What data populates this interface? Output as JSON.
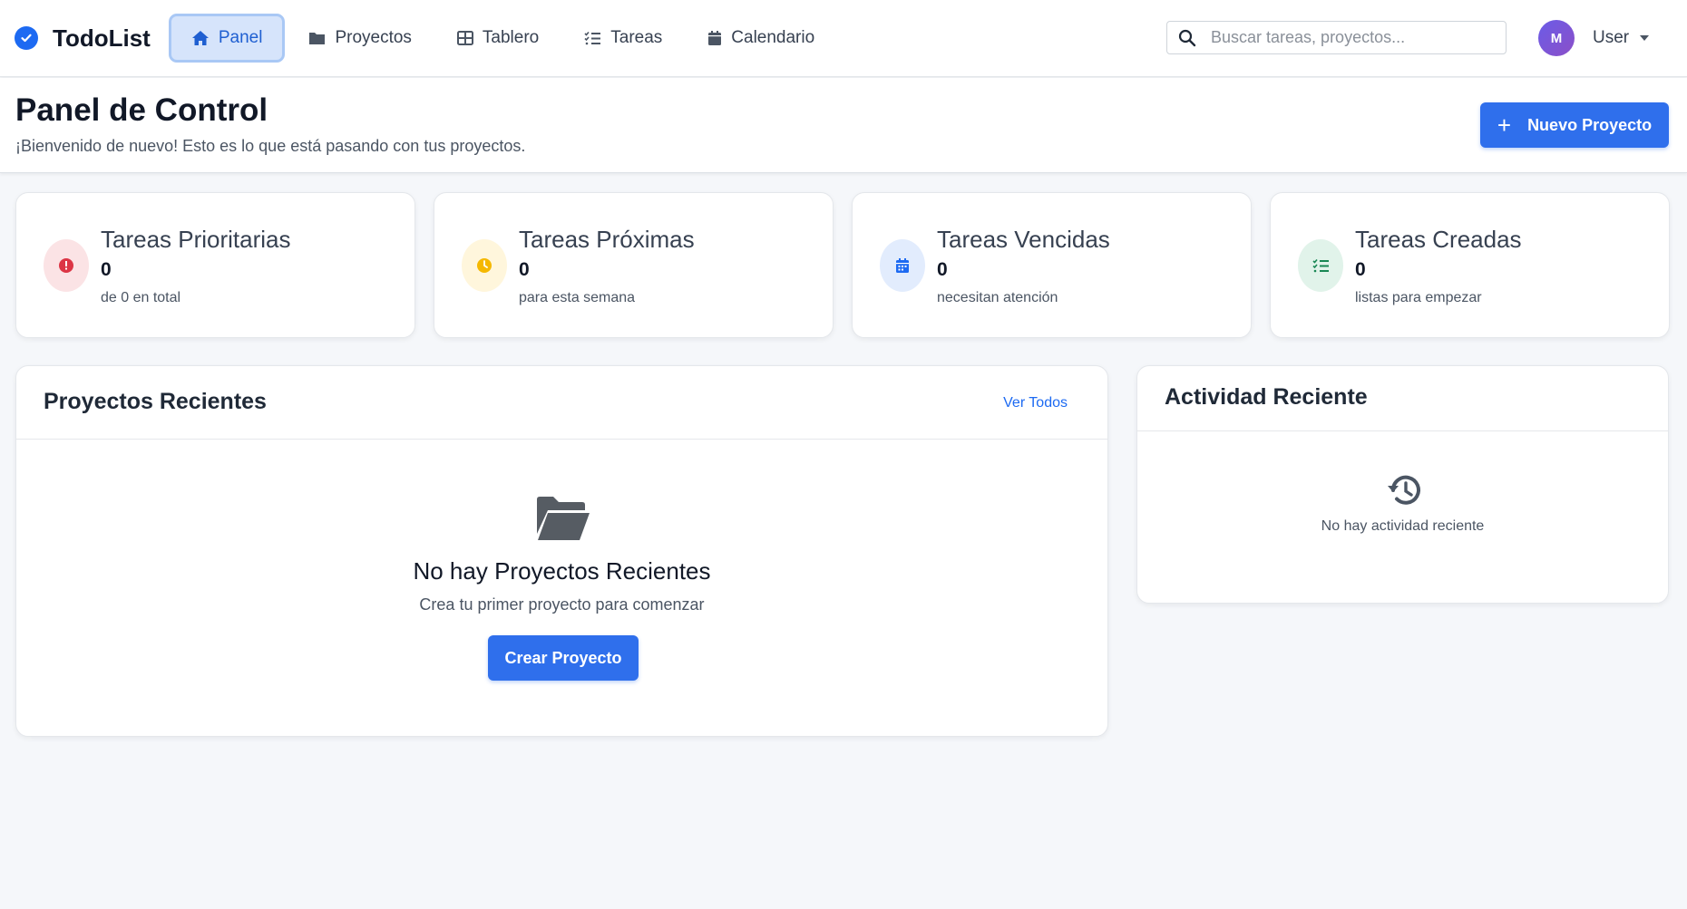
{
  "brand": {
    "name": "TodoList"
  },
  "nav": [
    {
      "label": "Panel",
      "icon": "home-icon",
      "active": true
    },
    {
      "label": "Proyectos",
      "icon": "folder-icon"
    },
    {
      "label": "Tablero",
      "icon": "table-icon"
    },
    {
      "label": "Tareas",
      "icon": "tasks-icon"
    },
    {
      "label": "Calendario",
      "icon": "calendar-icon"
    }
  ],
  "search": {
    "placeholder": "Buscar tareas, proyectos...",
    "value": ""
  },
  "user": {
    "initial": "M",
    "name": "User"
  },
  "header": {
    "title": "Panel de Control",
    "subtitle": "¡Bienvenido de nuevo! Esto es lo que está pasando con tus proyectos.",
    "new_project_label": "Nuevo Proyecto"
  },
  "stats": [
    {
      "title": "Tareas Prioritarias",
      "value": "0",
      "desc": "de 0 en total",
      "icon": "exclamation-icon",
      "color": "#dc3545",
      "bg": "#fbe3e5"
    },
    {
      "title": "Tareas Próximas",
      "value": "0",
      "desc": "para esta semana",
      "icon": "clock-icon",
      "color": "#f5b800",
      "bg": "#fff6dc"
    },
    {
      "title": "Tareas Vencidas",
      "value": "0",
      "desc": "necesitan atención",
      "icon": "calendar-icon",
      "color": "#1d6af2",
      "bg": "#e2ecfd"
    },
    {
      "title": "Tareas Creadas",
      "value": "0",
      "desc": "listas para empezar",
      "icon": "tasks-icon",
      "color": "#198754",
      "bg": "#e1f3ea"
    }
  ],
  "recent_projects": {
    "title": "Proyectos Recientes",
    "view_all": "Ver Todos",
    "empty_title": "No hay Proyectos Recientes",
    "empty_sub": "Crea tu primer proyecto para comenzar",
    "create_label": "Crear Proyecto"
  },
  "recent_activity": {
    "title": "Actividad Reciente",
    "empty": "No hay actividad reciente"
  }
}
